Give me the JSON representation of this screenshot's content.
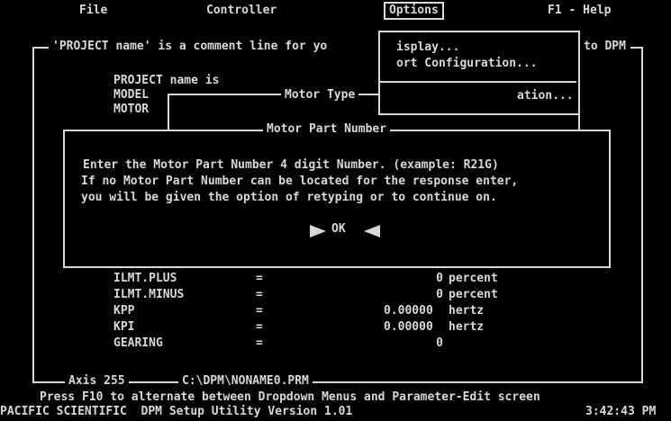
{
  "menu": {
    "file": "File",
    "controller": "Controller",
    "options": "Options",
    "help": "F1 - Help"
  },
  "options_menu": {
    "item1": "isplay...",
    "item2": "ort Configuration...",
    "item3": "ation..."
  },
  "comment_line": "'PROJECT name' is a comment line for yo",
  "comment_tail": "to DPM",
  "fields": {
    "project": "PROJECT name is",
    "model": "MODEL",
    "motor": "MOTOR"
  },
  "motor_type_title": "Motor Type",
  "dialog": {
    "title": "Motor Part Number",
    "line1": "Enter the Motor Part Number 4 digit Number. (example: R21G)",
    "line2": "If no Motor Part Number can be located for the response enter,",
    "line3": "you will be given the option of retyping or to continue on.",
    "ok": "OK"
  },
  "params": [
    {
      "name": "ILMT.PLUS",
      "eq": "=",
      "value": "0",
      "unit": "percent"
    },
    {
      "name": "ILMT.MINUS",
      "eq": "=",
      "value": "0",
      "unit": "percent"
    },
    {
      "name": "KPP",
      "eq": "=",
      "value": "0.00000",
      "unit": "hertz"
    },
    {
      "name": "KPI",
      "eq": "=",
      "value": "0.00000",
      "unit": "hertz"
    },
    {
      "name": "GEARING",
      "eq": "=",
      "value": "0",
      "unit": ""
    }
  ],
  "status": {
    "axis": "Axis 255",
    "file": "C:\\DPM\\NONAME0.PRM",
    "hint": "Press F10 to alternate between Dropdown Menus and Parameter-Edit screen",
    "product": "PACIFIC SCIENTIFIC  DPM Setup Utility Version 1.01",
    "time": "3:42:43 PM"
  }
}
